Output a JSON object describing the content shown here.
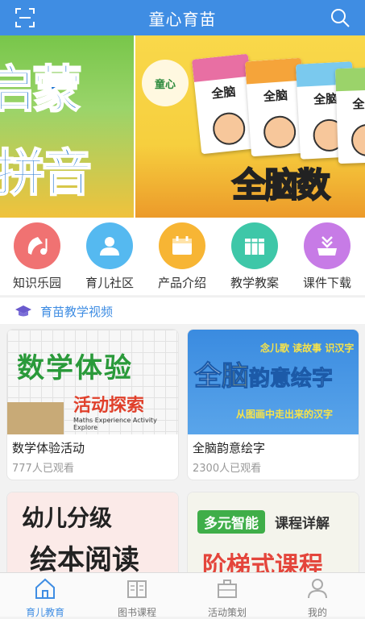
{
  "header": {
    "title": "童心育苗"
  },
  "banner": {
    "left_line1": "启蒙",
    "left_line2": "拼音",
    "logo_text": "童心",
    "book_title": "全脑",
    "right_text": "全脑数"
  },
  "menu": {
    "items": [
      {
        "label": "知识乐园",
        "icon": "music-knowledge-icon",
        "color": "#f07272"
      },
      {
        "label": "育儿社区",
        "icon": "user-icon",
        "color": "#55b9f0"
      },
      {
        "label": "产品介绍",
        "icon": "calendar-icon",
        "color": "#f7b534"
      },
      {
        "label": "教学教案",
        "icon": "books-icon",
        "color": "#3ec7a8"
      },
      {
        "label": "课件下载",
        "icon": "download-icon",
        "color": "#c77be6"
      }
    ]
  },
  "section": {
    "title": "育苗教学视频"
  },
  "cards": [
    {
      "title": "数学体验活动",
      "views": "777人已观看",
      "thumb_main": "数学体验",
      "thumb_sub": "活动探索",
      "thumb_en": "Maths Experience Activity Explore"
    },
    {
      "title": "全脑韵意绘字",
      "views": "2300人已观看",
      "thumb_main_a": "全",
      "thumb_main_b": "脑",
      "thumb_main_c": "韵意绘字",
      "thumb_top": "念儿歌 读故事 识汉字",
      "thumb_sub": "从图画中走出来的汉字"
    },
    {
      "thumb_a": "幼儿分级",
      "thumb_b": "绘本阅读"
    },
    {
      "thumb_badge": "多元智能",
      "thumb_detail": "课程详解",
      "thumb_big": "阶梯式课程"
    }
  ],
  "bottom_nav": {
    "items": [
      {
        "label": "育儿教育",
        "active": true
      },
      {
        "label": "图书课程",
        "active": false
      },
      {
        "label": "活动策划",
        "active": false
      },
      {
        "label": "我的",
        "active": false
      }
    ]
  },
  "colors": {
    "primary": "#3f8de3",
    "background": "#f2f2f2"
  }
}
